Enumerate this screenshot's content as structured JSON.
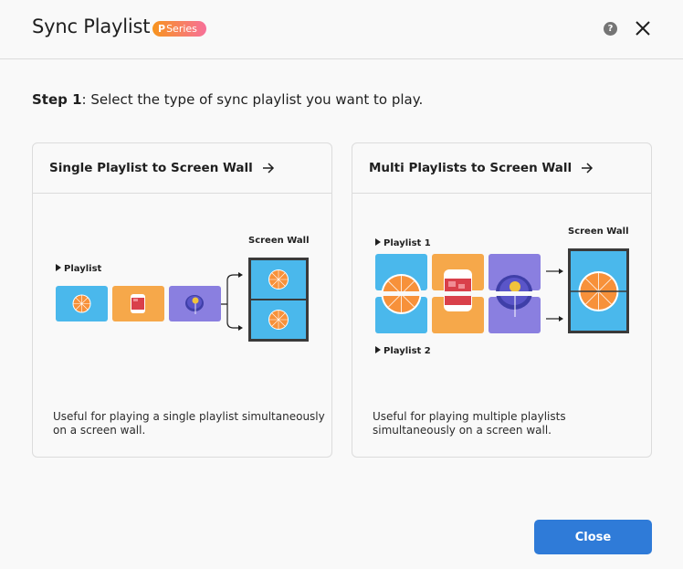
{
  "header": {
    "title": "Sync Playlist",
    "badge_letter": "P",
    "badge_text": "Series",
    "help_icon": "help-circle-icon",
    "close_icon": "close-icon"
  },
  "step": {
    "label": "Step 1",
    "text": ": Select the type of sync playlist you want to play."
  },
  "cards": [
    {
      "title": "Single Playlist to Screen Wall",
      "arrow_icon": "arrow-right-icon",
      "illustration": {
        "playlist_label": "Playlist",
        "screen_wall_label": "Screen Wall",
        "tiles": [
          "orange",
          "drink",
          "lollipop"
        ]
      },
      "description": "Useful for playing a single playlist simultaneously on a screen wall."
    },
    {
      "title": "Multi Playlists to Screen Wall",
      "arrow_icon": "arrow-right-icon",
      "illustration": {
        "playlist1_label": "Playlist 1",
        "playlist2_label": "Playlist 2",
        "screen_wall_label": "Screen Wall",
        "tiles": [
          "orange",
          "drink",
          "lollipop"
        ]
      },
      "description": "Useful for playing multiple playlists simultaneously on a screen wall."
    }
  ],
  "footer": {
    "close_label": "Close"
  },
  "colors": {
    "accent": "#2f7bd8",
    "tile_blue": "#4ab8ec",
    "tile_orange": "#f6a84a",
    "tile_purple": "#8a7fe0",
    "orange_fruit": "#f7913a",
    "badge_start": "#f7941d",
    "badge_end": "#f7709a"
  }
}
